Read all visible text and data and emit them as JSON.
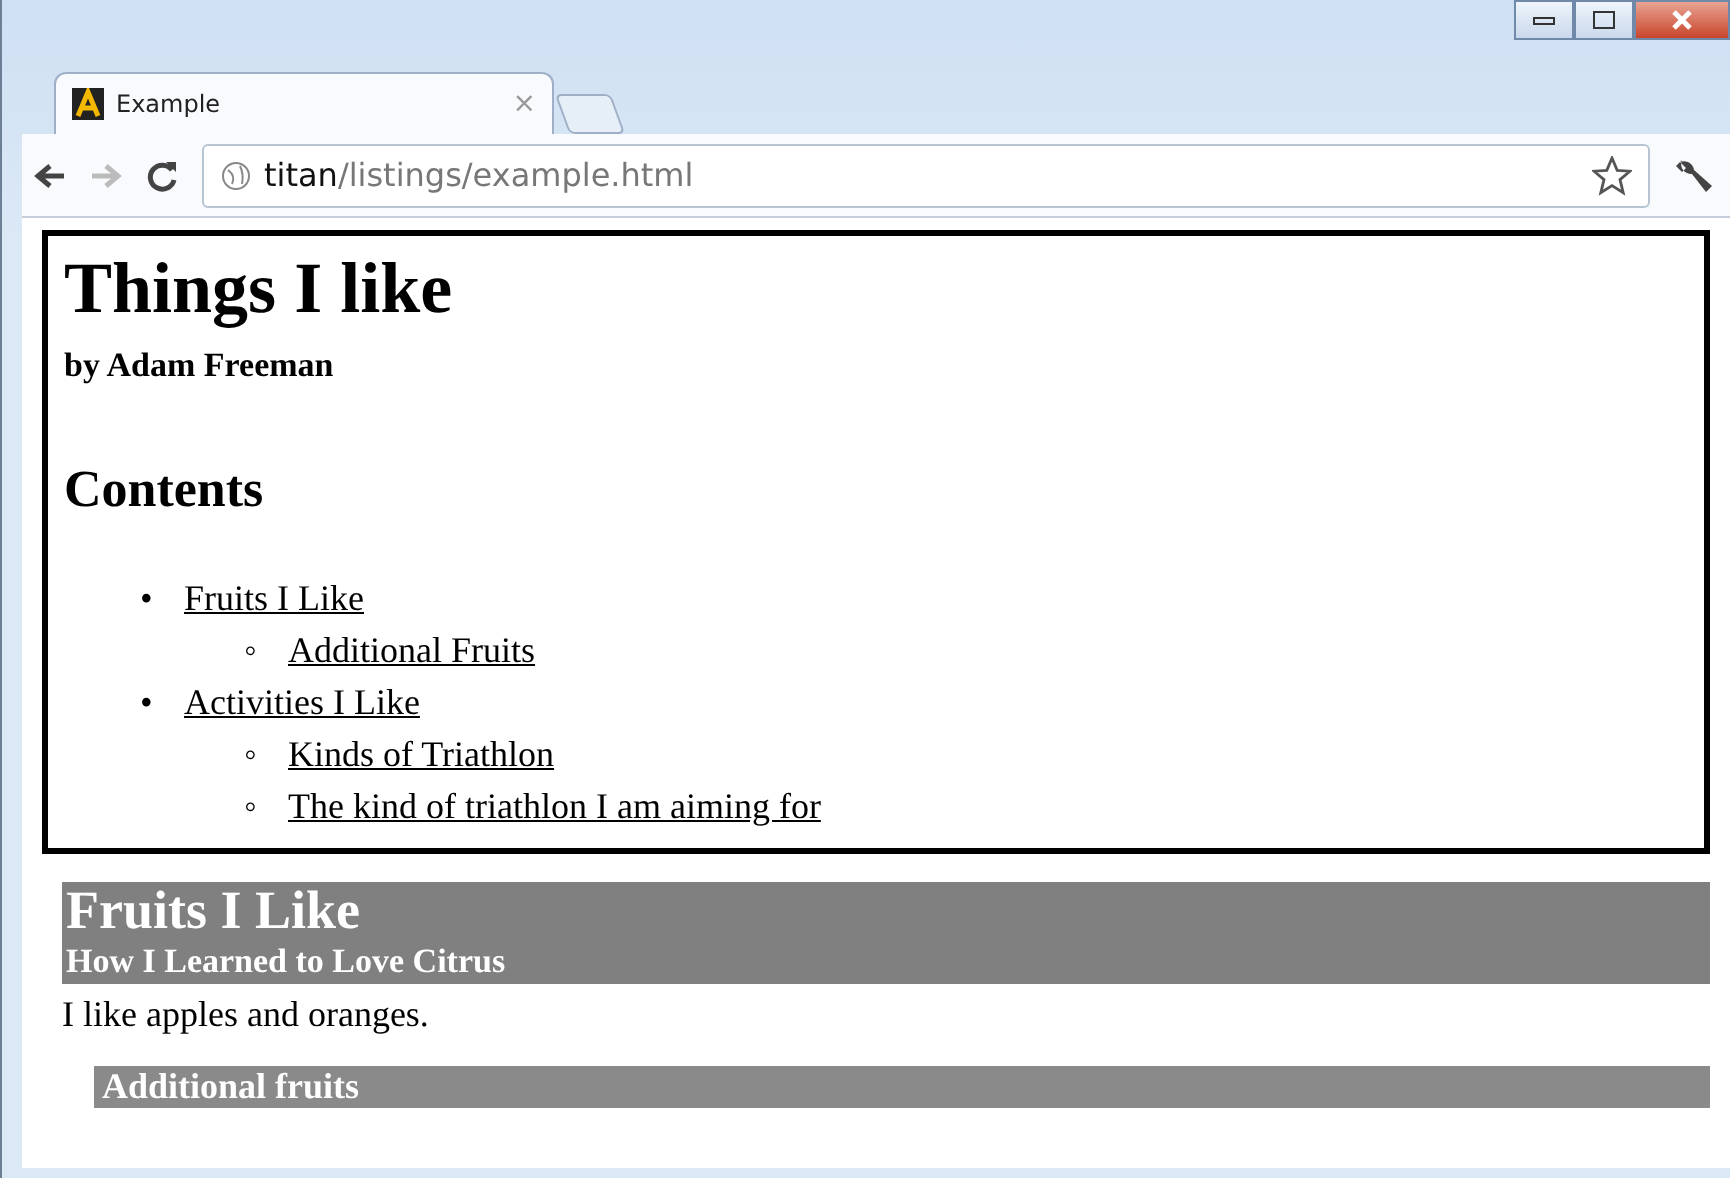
{
  "window": {
    "tab_title": "Example",
    "tab_close": "×",
    "address": {
      "host": "titan",
      "path": "/listings/example.html"
    }
  },
  "page": {
    "title": "Things I like",
    "byline": "by Adam Freeman",
    "contents_heading": "Contents",
    "contents": [
      {
        "marker": "•",
        "label": "Fruits I Like",
        "children": [
          {
            "marker": "◦",
            "label": "Additional Fruits"
          }
        ]
      },
      {
        "marker": "•",
        "label": "Activities I Like",
        "children": [
          {
            "marker": "◦",
            "label": "Kinds of Triathlon"
          },
          {
            "marker": "◦",
            "label": "The kind of triathlon I am aiming for"
          }
        ]
      }
    ],
    "section": {
      "heading": "Fruits I Like",
      "subheading": "How I Learned to Love Citrus",
      "text": "I like apples and oranges."
    },
    "subsection": {
      "heading": "Additional fruits"
    }
  }
}
